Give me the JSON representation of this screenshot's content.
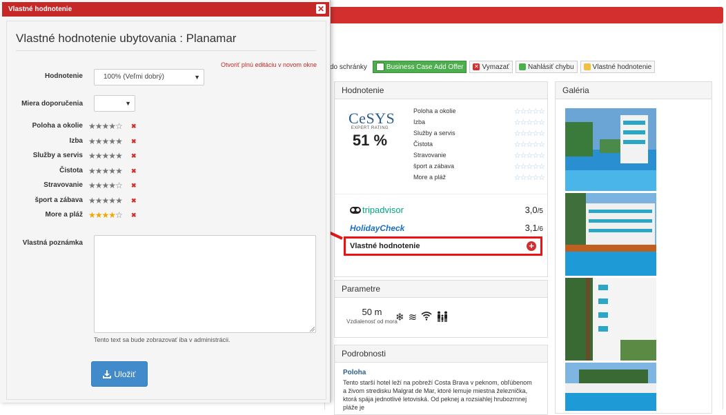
{
  "modal": {
    "window_title": "Vlastné hodnotenie",
    "heading": "Vlastné hodnotenie ubytovania : Planamar",
    "full_edit_link": "Otvoriť plnú editáciu v novom okne",
    "rating_label": "Hodnotenie",
    "rating_value": "100% (Veľmi dobrý)",
    "recommend_label": "Miera doporučenia",
    "recommend_value": "",
    "criteria": [
      {
        "label": "Poloha a okolie",
        "stars": 4
      },
      {
        "label": "Izba",
        "stars": 5
      },
      {
        "label": "Služby a servis",
        "stars": 5
      },
      {
        "label": "Čistota",
        "stars": 5
      },
      {
        "label": "Stravovanie",
        "stars": 4
      },
      {
        "label": "šport a zábava",
        "stars": 5
      },
      {
        "label": "More a pláž",
        "stars": 4,
        "highlighted": true
      }
    ],
    "note_label": "Vlastná poznámka",
    "note_value": "",
    "note_help": "Tento text sa bude zobrazovať iba v administrácii.",
    "save_label": "Uložiť"
  },
  "toolbar": {
    "items": [
      "do schránky",
      "Business Case Add Offer",
      "Vymazať",
      "Nahlásiť chybu",
      "Vlastné hodnotenie"
    ]
  },
  "rating_panel": {
    "title": "Hodnotenie",
    "cesys_logo": "CeSYS",
    "cesys_sub": "EXPERT RATING",
    "cesys_score": "51 %",
    "criteria": [
      "Poloha a okolie",
      "Izba",
      "Služby a servis",
      "Čistota",
      "Stravovanie",
      "šport a zábava",
      "More a pláž"
    ],
    "tripadvisor_name": "tripadvisor",
    "tripadvisor_score": "3,0",
    "tripadvisor_max": "/5",
    "holidaycheck_name": "HolidayCheck",
    "holidaycheck_score": "3,1",
    "holidaycheck_max": "/6",
    "custom_label": "Vlastné hodnotenie"
  },
  "params_panel": {
    "title": "Parametre",
    "distance": "50 m",
    "distance_label": "Vzdialenosť od mora"
  },
  "details_panel": {
    "title": "Podrobnosti",
    "section": "Poloha",
    "text": "Tento starší hotel leží na pobreží Costa Brava v peknom, obľúbenom a živom stredisku Malgrat de Mar, ktoré lemuje miestna železnička, ktorá spája jednotlivé letoviská. Od peknej a rozsiahlej hrubozrnnej pláže je"
  },
  "gallery_panel": {
    "title": "Galéria"
  },
  "colors": {
    "brand_red": "#c62828",
    "star_gray": "#777777",
    "star_gold": "#f0a800",
    "primary_blue": "#428bca"
  }
}
